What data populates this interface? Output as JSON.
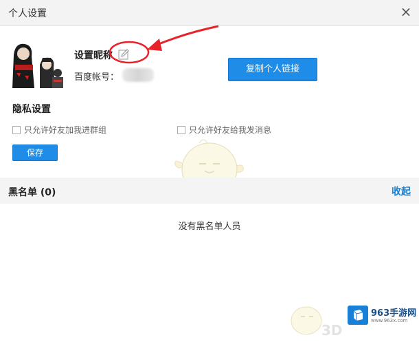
{
  "window": {
    "title": "个人设置",
    "close_label": "×"
  },
  "profile": {
    "nickname_label": "设置昵称",
    "baidu_account_label": "百度帐号：",
    "copy_link_button": "复制个人链接"
  },
  "privacy": {
    "title": "隐私设置",
    "options": [
      {
        "label": "只允许好友加我进群组",
        "checked": false
      },
      {
        "label": "只允许好友给我发消息",
        "checked": false
      }
    ],
    "save_button": "保存"
  },
  "blacklist": {
    "title": "黑名单 (0)",
    "collapse_label": "收起",
    "empty_text": "没有黑名单人员"
  },
  "watermark": {
    "brand": "963手游网",
    "domain": "www.963x.com",
    "text_3d": "3D"
  },
  "colors": {
    "accent": "#1f8ce8",
    "link": "#1480d6",
    "annotation": "#e8222a"
  }
}
